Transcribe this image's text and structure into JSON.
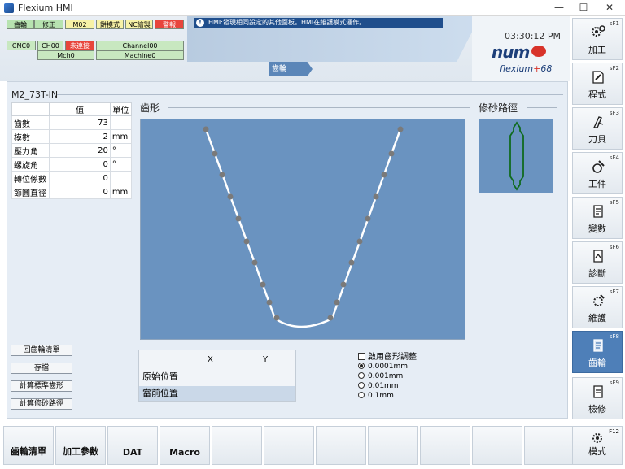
{
  "window": {
    "title": "Flexium HMI",
    "min": "—",
    "max": "☐",
    "close": "✕"
  },
  "status": {
    "row1": [
      "齒輪",
      "修正",
      "M02",
      "餅模式",
      "NC繪製",
      "警報"
    ],
    "row2": [
      "CNC0",
      "CH00",
      "未連接",
      "Channel00"
    ],
    "row3": [
      "Mch0",
      "Machine0"
    ],
    "message": "HMI:發現相同設定的其他面板。HMI在維護模式運作。"
  },
  "clock": "03:30:12 PM",
  "logo": {
    "brand": "num",
    "product": "flexium",
    "plus": "+",
    "version": "68"
  },
  "breadcrumb": "齒輪",
  "main": {
    "title": "M2_73T-IN",
    "table": {
      "headers": [
        "",
        "值",
        "單位"
      ],
      "rows": [
        {
          "label": "齒數",
          "value": "73",
          "unit": ""
        },
        {
          "label": "模數",
          "value": "2",
          "unit": "mm"
        },
        {
          "label": "壓力角",
          "value": "20",
          "unit": "°"
        },
        {
          "label": "螺旋角",
          "value": "0",
          "unit": "°"
        },
        {
          "label": "轉位係數",
          "value": "0",
          "unit": ""
        },
        {
          "label": "節圓直徑",
          "value": "0",
          "unit": "mm"
        }
      ]
    },
    "buttons": [
      "回齒輪清單",
      "存檔",
      "計算標準齒形",
      "計算修砂路徑"
    ],
    "tooth_title": "齒形",
    "dress_title": "修砂路徑",
    "position": {
      "x_label": "X",
      "y_label": "Y",
      "start": "原始位置",
      "current": "當前位置"
    },
    "enable_adjust": "啟用齒形調整",
    "resolution": [
      "0.0001mm",
      "0.001mm",
      "0.01mm",
      "0.1mm"
    ],
    "resolution_selected": 0
  },
  "softkeys": [
    {
      "num": "sF1",
      "label": "加工",
      "icon": "gears-icon"
    },
    {
      "num": "sF2",
      "label": "程式",
      "icon": "program-icon"
    },
    {
      "num": "sF3",
      "label": "刀具",
      "icon": "tool-icon"
    },
    {
      "num": "sF4",
      "label": "工件",
      "icon": "workpiece-icon"
    },
    {
      "num": "sF5",
      "label": "變數",
      "icon": "variables-icon"
    },
    {
      "num": "sF6",
      "label": "診斷",
      "icon": "diagnosis-icon"
    },
    {
      "num": "sF7",
      "label": "維護",
      "icon": "maintenance-icon"
    },
    {
      "num": "sF8",
      "label": "齒輪",
      "icon": "gear-doc-icon"
    },
    {
      "num": "sF9",
      "label": "檢修",
      "icon": "inspect-icon"
    }
  ],
  "active_softkey": 7,
  "bottom_keys": [
    "齒輪清單",
    "加工參數",
    "DAT",
    "Macro",
    "",
    "",
    "",
    "",
    "",
    "",
    ""
  ],
  "mode_key": {
    "num": "F12",
    "label": "模式"
  },
  "colors": {
    "plot_bg": "#6a93c0",
    "accent": "#4e7fb8",
    "alarm": "#e8453c"
  }
}
